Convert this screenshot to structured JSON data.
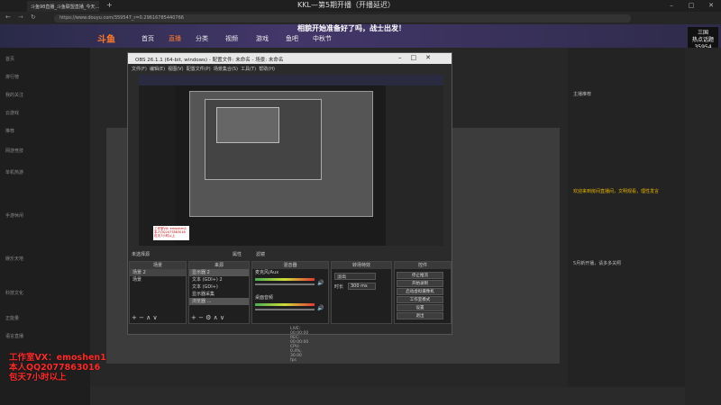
{
  "browser": {
    "tab_title": "斗鱼98直播_斗鱼联盟直播_今天…",
    "url": "https://www.douyu.com/359547_r=0.29616785440766",
    "overlay_title": "KKL—第5期开播（开播延迟）",
    "window_buttons": [
      "–",
      "□",
      "✕"
    ]
  },
  "site": {
    "logo": "斗鱼",
    "nav": [
      "首页",
      "直播",
      "分类",
      "视频",
      "游戏",
      "鱼吧",
      "中秋节"
    ],
    "banner_text": "相貌开始准备好了吗，战士出发！",
    "side_items": [
      "首页",
      "排行榜",
      "我的关注",
      "云游戏",
      "推荐",
      "网游竞技",
      "单机热游",
      "手游休闲",
      "娱乐天地",
      "科技文化",
      "正能量",
      "语言直播"
    ],
    "right_badge": "三国\n热点话题\n35954"
  },
  "obs": {
    "title": "OBS 26.1.1 (64-bit, windows) - 配置文件: 未命名 - 场景: 未命名",
    "menu": [
      "文件(F)",
      "编辑(E)",
      "视图(V)",
      "配置文件(P)",
      "场景集合(S)",
      "工具(T)",
      "帮助(H)"
    ],
    "preview_watermark": "工作室VX: emoshen1 本人QQ2077863016 包天7小时以上",
    "scene_bar": [
      "未选择源",
      "属性",
      "滤镜"
    ],
    "docks": {
      "scenes": {
        "header": "场景",
        "items": [
          "场景 2",
          "场景"
        ]
      },
      "sources": {
        "header": "来源",
        "items": [
          "显示器 2",
          "文本 (GDI+) 2",
          "文本 (GDI+)",
          "显示器采集",
          "浏览器 …"
        ]
      },
      "mixer": {
        "header": "混音器",
        "items": [
          "麦克风/Aux",
          "桌面音频"
        ]
      },
      "transitions": {
        "header": "转场特效",
        "type": "淡出",
        "duration_label": "时长",
        "duration": "300 ms"
      },
      "controls": {
        "header": "控件",
        "buttons": [
          "停止推流",
          "开始录制",
          "启动虚拟摄像机",
          "工作室模式",
          "设置",
          "退出"
        ]
      }
    },
    "status": "LIVE: 00:00:00   REC: 00:00:00   CPU: 0.4%, 30.00 fps"
  },
  "watermark": {
    "line1": "工作室VX：emoshen1",
    "line2": "本人QQ2077863016",
    "line3": "包天7小时以上"
  },
  "chat": [
    "欢迎来到房间直播间，文明观看，理性发言",
    "主播推荐",
    "5月新开播，请多多关照"
  ]
}
